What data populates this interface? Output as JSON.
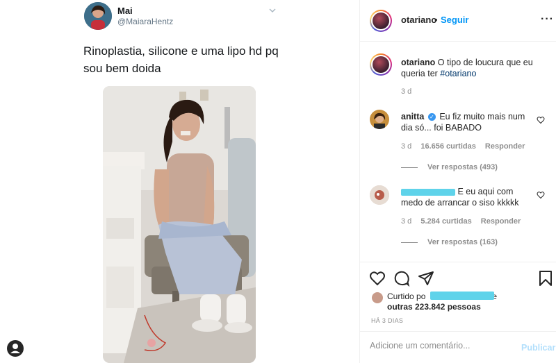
{
  "tweet": {
    "name": "Mai",
    "handle": "@MaiaraHentz",
    "text": "Rinoplastia, silicone e uma lipo hd pq sou bem doida"
  },
  "post": {
    "username": "otariano",
    "dot": "•",
    "follow_label": "Seguir",
    "more_label": "···",
    "caption_text": "O tipo de loucura que eu queria ter",
    "caption_hashtag": "#otariano",
    "caption_time": "3 d"
  },
  "comments": [
    {
      "username": "anitta",
      "verified": true,
      "text": "Eu fiz muito mais num dia só... foi BABADO",
      "time": "3 d",
      "likes": "16.656 curtidas",
      "reply_label": "Responder",
      "view_replies": "Ver respostas (493)"
    },
    {
      "username": "",
      "text": "E eu aqui com medo de arrancar o siso kkkkk",
      "time": "3 d",
      "likes": "5.284 curtidas",
      "reply_label": "Responder",
      "view_replies": "Ver respostas (163)"
    }
  ],
  "likes": {
    "prefix": "Curtido po",
    "suffix": "e",
    "others": "outras 223.842 pessoas"
  },
  "ago": "HÁ 3 DIAS",
  "add_comment": {
    "placeholder": "Adicione um comentário...",
    "publish_label": "Publicar"
  },
  "colors": {
    "link_blue": "#0095f6",
    "publish_disabled": "#b2dffc",
    "redaction": "#5fd3ea",
    "muted": "#8e8e8e"
  },
  "icons": [
    "chevron-down-icon",
    "more-icon",
    "verified-icon",
    "heart-icon",
    "comment-icon",
    "share-icon",
    "bookmark-icon",
    "user-icon"
  ]
}
